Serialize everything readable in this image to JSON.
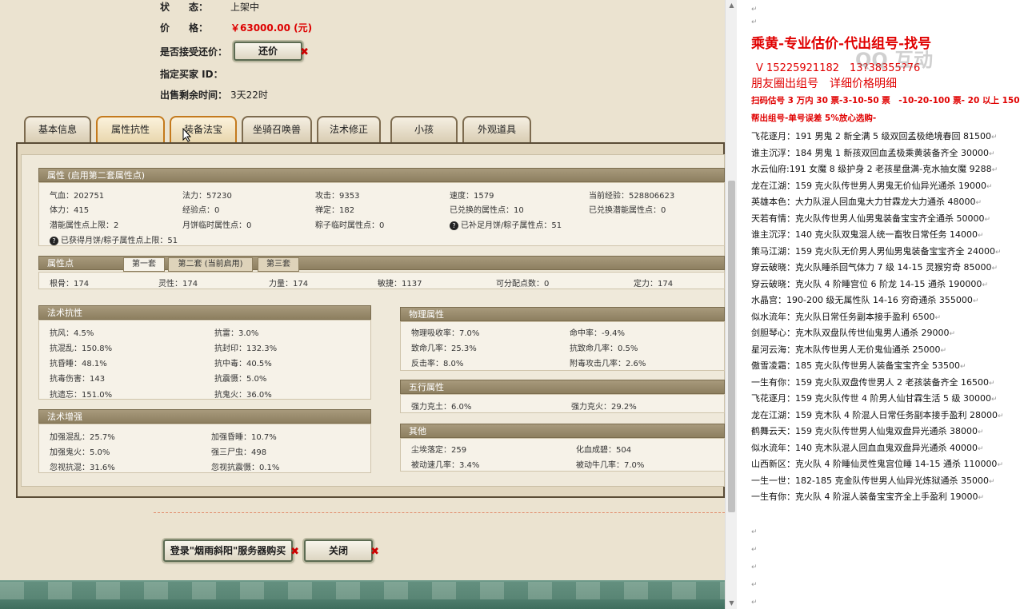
{
  "listing": {
    "status_label": "状　　态：",
    "status_value": "上架中",
    "price_label": "价　　格：",
    "price_value": "￥63000.00 (元)",
    "bargain_label": "是否接受还价：",
    "bargain_button": "还价",
    "buyer_label": "指定买家 ID：",
    "buyer_value": "",
    "remaining_label": "出售剩余时间：",
    "remaining_value": "3天22时"
  },
  "tabs": [
    {
      "label": "基本信息"
    },
    {
      "label": "属性抗性"
    },
    {
      "label": "装备法宝"
    },
    {
      "label": "坐骑召唤兽"
    },
    {
      "label": "法术修正"
    },
    {
      "label": "小孩"
    },
    {
      "label": "外观道具"
    }
  ],
  "attributes": {
    "header": "属性 (启用第二套属性点)",
    "row1": [
      "气血：202751",
      "法力：57230",
      "攻击：9353",
      "速度：1579",
      "当前经验：528806623"
    ],
    "row2": [
      "体力：415",
      "经验点：0",
      "禅定：182",
      "已兑换的属性点：10",
      "已兑换潜能属性点：0"
    ],
    "row3": [
      "潜能属性点上限：2",
      "月饼临时属性点：0",
      "粽子临时属性点：0",
      "已补足月饼/粽子属性点：51"
    ],
    "row4": "已获得月饼/粽子属性点上限：51"
  },
  "attr_points": {
    "header": "属性点",
    "subtabs": [
      "第一套",
      "第二套 (当前启用)",
      "第三套"
    ],
    "values": [
      "根骨：174",
      "灵性：174",
      "力量：174",
      "敏捷：1137",
      "可分配点数：0",
      "定力：174"
    ]
  },
  "magic_resist": {
    "header": "法术抗性",
    "cells": [
      "抗风：4.5%",
      "抗雷：3.0%",
      "抗混乱：150.8%",
      "抗封印：132.3%",
      "抗昏睡：48.1%",
      "抗中毒：40.5%",
      "抗毒伤害：143",
      "抗震慑：5.0%",
      "抗遗忘：151.0%",
      "抗鬼火：36.0%"
    ]
  },
  "magic_boost": {
    "header": "法术增强",
    "cells": [
      "加强混乱：25.7%",
      "加强昏睡：10.7%",
      "加强鬼火：5.0%",
      "强三尸虫：498",
      "忽视抗混：31.6%",
      "忽视抗震慑：0.1%"
    ]
  },
  "physical": {
    "header": "物理属性",
    "cells": [
      "物理吸收率：7.0%",
      "命中率：-9.4%",
      "致命几率：25.3%",
      "抗致命几率：0.5%",
      "反击率：8.0%",
      "附毒攻击几率：2.6%"
    ]
  },
  "five_elements": {
    "header": "五行属性",
    "cells": [
      "强力克土：6.0%",
      "强力克火：29.2%"
    ]
  },
  "other": {
    "header": "其他",
    "cells": [
      "尘埃落定：259",
      "化血成碧：504",
      "被动速几率：3.4%",
      "被动牛几率：7.0%"
    ]
  },
  "bottom_buttons": {
    "login": "登录\"烟雨斜阳\"服务器购买",
    "close": "关闭"
  },
  "doc": {
    "title": "乘黄-专业估价-代出组号-找号",
    "contact": "V 15225921182　13?38355?76",
    "subtitle": "朋友圈出组号　详细价格明细",
    "pricing": "扫码估号 3 万内 30 票-3-10-50 票　-10-20-100 票- 20 以上 150",
    "pricing2": "帮出组号-单号误差 5%放心选购-",
    "watermark": "QQ 互动",
    "entries": [
      "飞花逐月：191 男鬼 2 新全满 5 级双回孟极绝境春回 81500",
      "谁主沉浮：184 男鬼 1 新孩双回血孟极乘黄装备齐全 30000",
      "水云仙府:191 女魔 8 级护身 2 老孩星盘满-克水抽女魔 9288",
      "龙在江湖：159 克火队传世男人男鬼无价仙异光通杀 19000",
      "英雄本色：大力队混人回血鬼大力甘霖龙大力通杀 48000",
      "天若有情：克火队传世男人仙男鬼装备宝宝齐全通杀 50000",
      "谁主沉浮：140 克火队双鬼混人统一畜牧日常任务 14000",
      "策马江湖：159 克火队无价男人男仙男鬼装备宝宝齐全 24000",
      "穿云破晓：克火队睡杀回气体力 7 级 14-15 灵猴穷奇 85000",
      "穿云破晓：克火队 4 阶睡宫位 6 阶龙 14-15 通杀 190000",
      "水晶宫：190-200 级无属性队 14-16 穷奇通杀 355000",
      "似水流年：克火队日常任务副本接手盈利 6500",
      "剑胆琴心：克木队双盘队传世仙鬼男人通杀 29000",
      "星河云海：克木队传世男人无价鬼仙通杀 25000",
      "傲雪凌霜：185 克火队传世男人装备宝宝齐全 53500",
      "一生有你：159 克火队双盘传世男人 2 老孩装备齐全 16500",
      "飞花逐月：159 克火队传世 4 阶男人仙甘霖生活 5 级 30000",
      "龙在江湖：159 克木队 4 阶混人日常任务副本接手盈利 28000",
      "鹤舞云天：159 克火队传世男人仙鬼双盘异光通杀 38000",
      "似水流年：140 克木队混人回血血鬼双盘异光通杀 40000",
      "山西新区：克火队 4 阶睡仙灵性鬼宫位睡 14-15 通杀 110000",
      "一生一世：182-185 克金队传世男人仙异光炼狱通杀 35000",
      "一生有你：克火队 4 阶混人装备宝宝齐全上手盈利 19000"
    ],
    "para_mark": "↵"
  }
}
